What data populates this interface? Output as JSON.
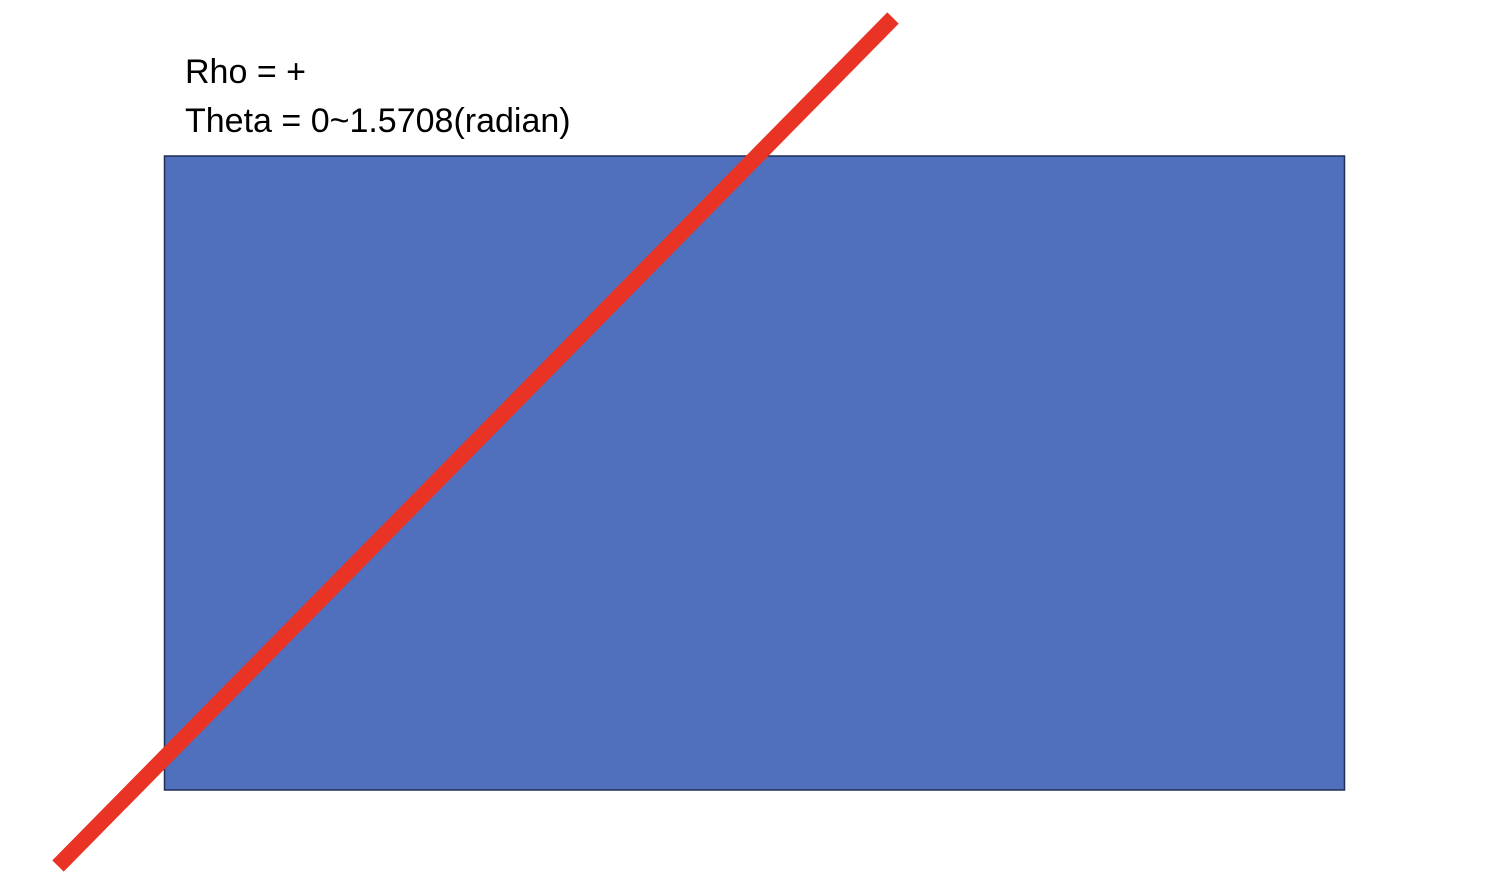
{
  "annotations": {
    "rho": "Rho = +",
    "theta": "Theta = 0~1.5708(radian)"
  },
  "colors": {
    "background": "#ffffff",
    "rectangle_fill": "#5070bd",
    "rectangle_stroke": "#1f2f55",
    "line": "#e83325",
    "text": "#000000"
  },
  "shapes": {
    "rectangle": "filled-rectangle",
    "line": "diagonal-red-line"
  }
}
